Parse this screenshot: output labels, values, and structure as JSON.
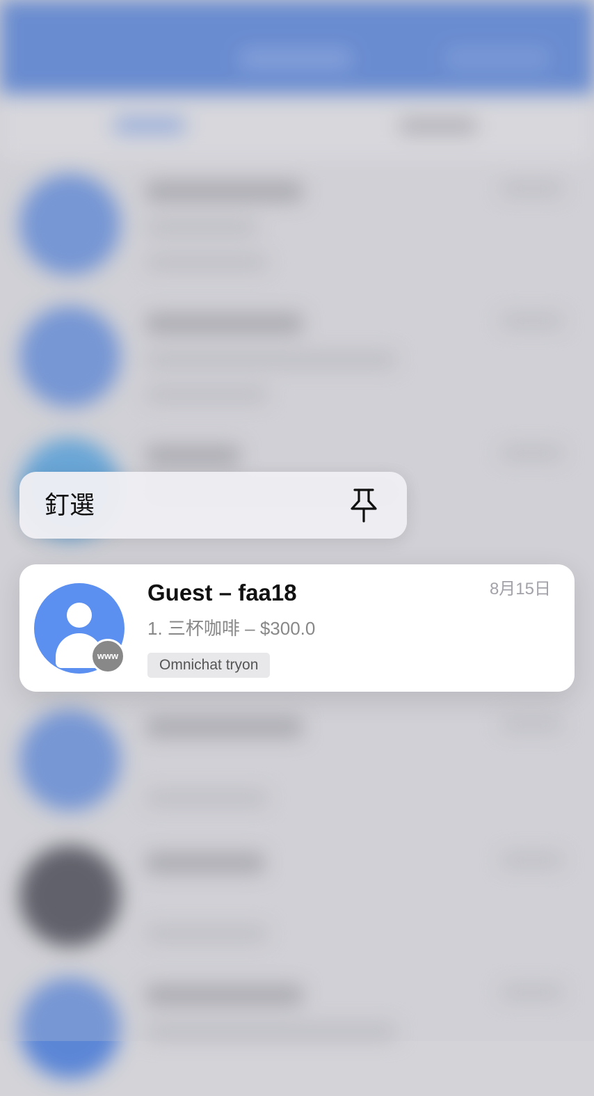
{
  "context_menu": {
    "pin_label": "釘選",
    "pin_icon": "pin-icon"
  },
  "conversation": {
    "name": "Guest – faa18",
    "date": "8月15日",
    "last_message": "1. 三杯咖啡 – $300.0",
    "tag": "Omnichat tryon",
    "channel_badge": "www",
    "avatar_icon": "default-user-avatar"
  },
  "colors": {
    "header_blue": "#4a78d0",
    "avatar_blue": "#5b8ff0",
    "badge_gray": "#888888"
  }
}
